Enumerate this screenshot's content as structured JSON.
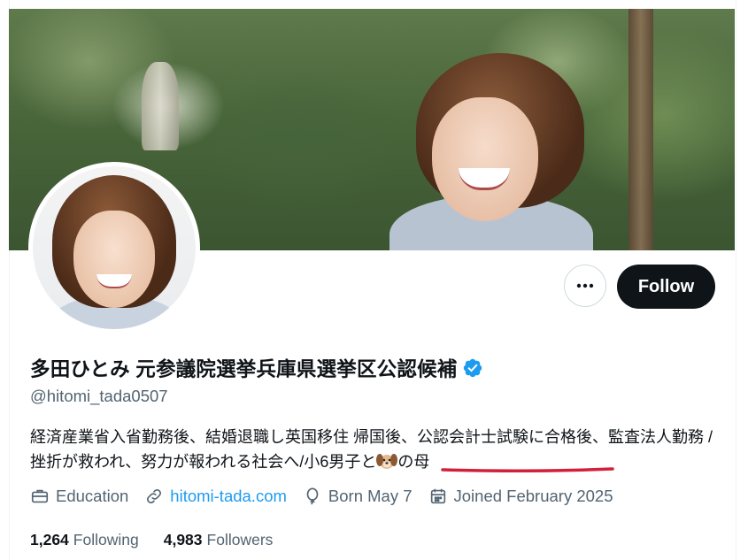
{
  "profile": {
    "display_name": "多田ひとみ 元参議院選挙兵庫県選挙区公認候補",
    "handle": "@hitomi_tada0507",
    "bio_main": "経済産業省入省勤務後、結婚退職し英国移住 帰国後、公認会計士試験に合格後、監査法人勤務 /挫折が救われ、努力が報われる社会へ/",
    "bio_tail_a": "小6男子と",
    "bio_tail_b": "の母",
    "verified": true
  },
  "actions": {
    "more_label": "•••",
    "follow_label": "Follow"
  },
  "meta": {
    "category": "Education",
    "website": "hitomi-tada.com",
    "birthday": "Born May 7",
    "joined": "Joined February 2025"
  },
  "stats": {
    "following_count": "1,264",
    "following_label": "Following",
    "followers_count": "4,983",
    "followers_label": "Followers"
  },
  "colors": {
    "accent": "#1d9bf0",
    "button": "#0f1419",
    "secondary_text": "#536471",
    "underline": "#d41f3a"
  },
  "icons": {
    "more": "more-horizontal-icon",
    "verified": "verified-badge-icon",
    "category": "briefcase-icon",
    "website": "link-icon",
    "birthday": "balloon-icon",
    "joined": "calendar-icon",
    "emoji": "dog-face-emoji"
  }
}
